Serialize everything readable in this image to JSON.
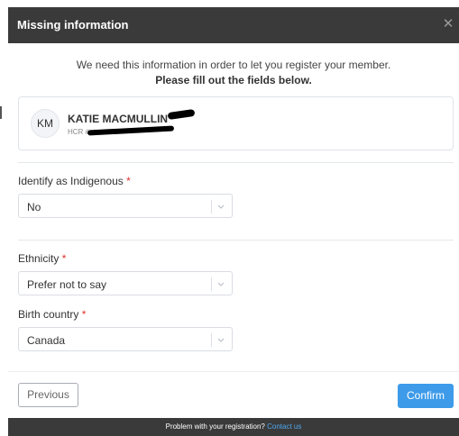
{
  "dialog": {
    "title": "Missing information",
    "close_icon": "close-icon"
  },
  "intro": {
    "line1": "We need this information in order to let you register your member.",
    "line2": "Please fill out the fields below."
  },
  "member": {
    "initials": "KM",
    "name": "KATIE MACMULLIN",
    "hcr_prefix": "HCR #"
  },
  "fields": {
    "indigenous": {
      "label": "Identify as Indigenous",
      "required_mark": "*",
      "value": "No"
    },
    "ethnicity": {
      "label": "Ethnicity",
      "required_mark": "*",
      "value": "Prefer not to say"
    },
    "birth_country": {
      "label": "Birth country",
      "required_mark": "*",
      "value": "Canada"
    }
  },
  "buttons": {
    "previous": "Previous",
    "confirm": "Confirm"
  },
  "footer": {
    "text": "Problem with your registration?",
    "link": "Contact us"
  },
  "colors": {
    "header_bg": "#3a3a3a",
    "accent": "#3d9be9",
    "required": "#e0312f",
    "link": "#4ea7f0"
  }
}
